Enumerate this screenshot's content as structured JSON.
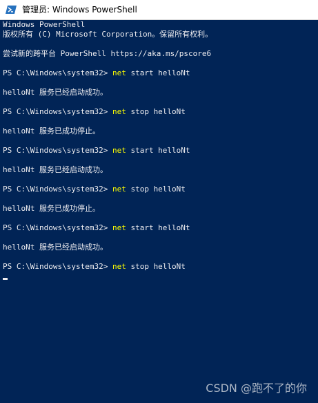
{
  "window": {
    "title": "管理员: Windows PowerShell",
    "background_color": "#012456",
    "text_color": "#eeedf0",
    "command_color": "#ffff00",
    "icon": "powershell-icon"
  },
  "console": {
    "header": [
      "Windows PowerShell",
      "版权所有 (C) Microsoft Corporation。保留所有权利。",
      "尝试新的跨平台 PowerShell https://aka.ms/pscore6"
    ],
    "entries": [
      {
        "prompt": "PS C:\\Windows\\system32> ",
        "command": "net",
        "args": " start helloNt",
        "output": "helloNt 服务已经启动成功。"
      },
      {
        "prompt": "PS C:\\Windows\\system32> ",
        "command": "net",
        "args": " stop helloNt",
        "output": "helloNt 服务已成功停止。"
      },
      {
        "prompt": "PS C:\\Windows\\system32> ",
        "command": "net",
        "args": " start helloNt",
        "output": "helloNt 服务已经启动成功。"
      },
      {
        "prompt": "PS C:\\Windows\\system32> ",
        "command": "net",
        "args": " stop helloNt",
        "output": "helloNt 服务已成功停止。"
      },
      {
        "prompt": "PS C:\\Windows\\system32> ",
        "command": "net",
        "args": " start helloNt",
        "output": "helloNt 服务已经启动成功。"
      },
      {
        "prompt": "PS C:\\Windows\\system32> ",
        "command": "net",
        "args": " stop helloNt",
        "output": ""
      }
    ]
  },
  "watermark": "CSDN @跑不了的你"
}
